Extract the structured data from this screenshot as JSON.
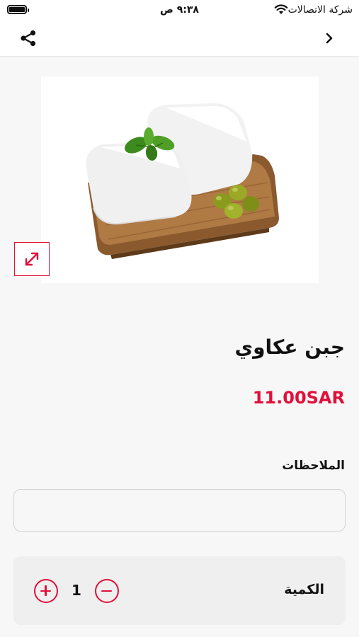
{
  "status_bar": {
    "time": "٩:٣٨ ص",
    "carrier": "شركة الاتصالات",
    "icons": [
      "battery-icon",
      "wifi-icon"
    ]
  },
  "nav": {
    "icons": [
      "share-icon",
      "chevron-right-icon"
    ]
  },
  "product": {
    "name": "جبن عكاوي",
    "price": "11.00SAR",
    "image": "cheese-on-wooden-board",
    "expand_icon": "expand-arrows-icon"
  },
  "notes": {
    "label": "الملاحظات",
    "value": "",
    "placeholder": ""
  },
  "quantity": {
    "label": "الكمية",
    "value": "1",
    "icons": [
      "plus-circle-icon",
      "minus-circle-icon"
    ]
  },
  "colors": {
    "accent": "#e0103a",
    "background": "#f7f7f7",
    "card": "#efefef"
  }
}
